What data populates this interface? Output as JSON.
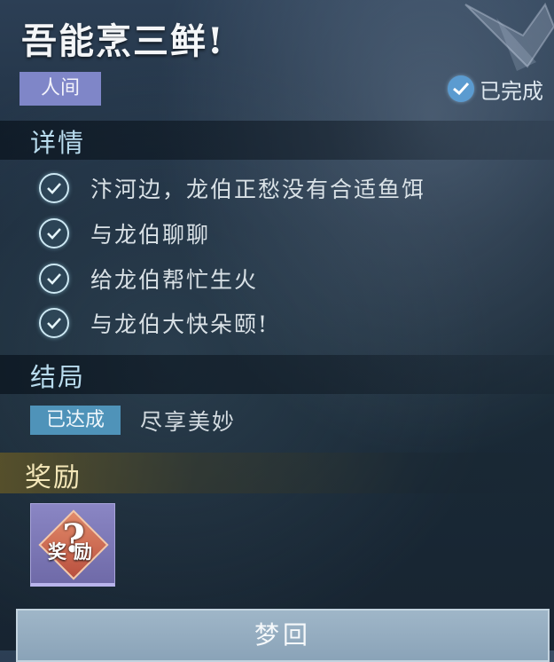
{
  "header": {
    "title": "吾能烹三鲜!",
    "realm_tag": "人间",
    "status": "已完成"
  },
  "details": {
    "section_title": "详情",
    "tasks": [
      "汴河边，龙伯正愁没有合适鱼饵",
      "与龙伯聊聊",
      "给龙伯帮忙生火",
      "与龙伯大快朵颐!"
    ]
  },
  "ending": {
    "section_title": "结局",
    "badge": "已达成",
    "text": "尽享美妙"
  },
  "rewards": {
    "section_title": "奖励",
    "item_label": "奖励",
    "item_mark": "?"
  },
  "actions": {
    "dream_button": "梦回"
  },
  "colors": {
    "realm_tag_bg": "#7f86c8",
    "ending_badge_bg": "#4f93b9",
    "section_title": "#b9dcee",
    "reward_title": "#f4e7b8"
  }
}
